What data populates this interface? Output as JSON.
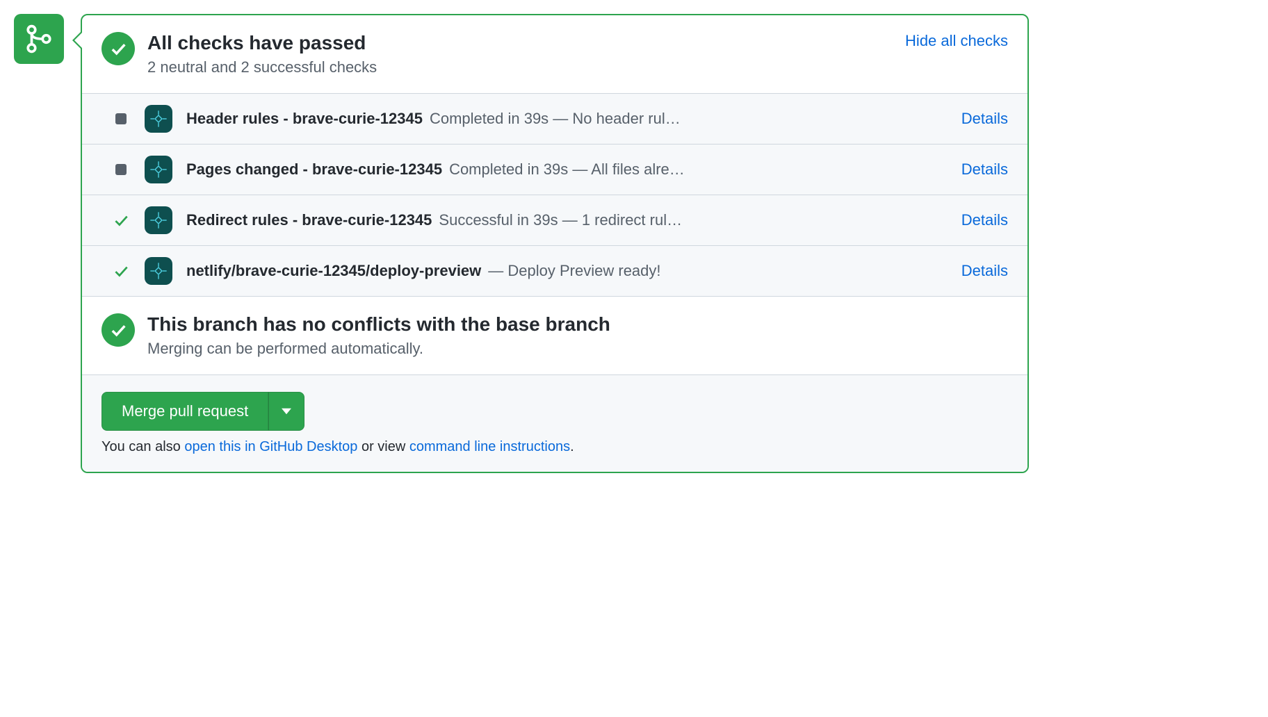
{
  "header": {
    "title": "All checks have passed",
    "subtitle": "2 neutral and 2 successful checks",
    "hide_link": "Hide all checks"
  },
  "checks": [
    {
      "status": "neutral",
      "name": "Header rules - brave-curie-12345",
      "description": "Completed in 39s — No header rul…",
      "details_label": "Details"
    },
    {
      "status": "neutral",
      "name": "Pages changed - brave-curie-12345",
      "description": "Completed in 39s — All files alre…",
      "details_label": "Details"
    },
    {
      "status": "success",
      "name": "Redirect rules - brave-curie-12345",
      "description": "Successful in 39s — 1 redirect rul…",
      "details_label": "Details"
    },
    {
      "status": "success",
      "name": "netlify/brave-curie-12345/deploy-preview",
      "description": "— Deploy Preview ready!",
      "details_label": "Details"
    }
  ],
  "conflicts": {
    "title": "This branch has no conflicts with the base branch",
    "subtitle": "Merging can be performed automatically."
  },
  "merge": {
    "button_label": "Merge pull request",
    "hint_prefix": "You can also ",
    "hint_desktop": "open this in GitHub Desktop",
    "hint_middle": " or view ",
    "hint_cli": "command line instructions",
    "hint_suffix": "."
  }
}
